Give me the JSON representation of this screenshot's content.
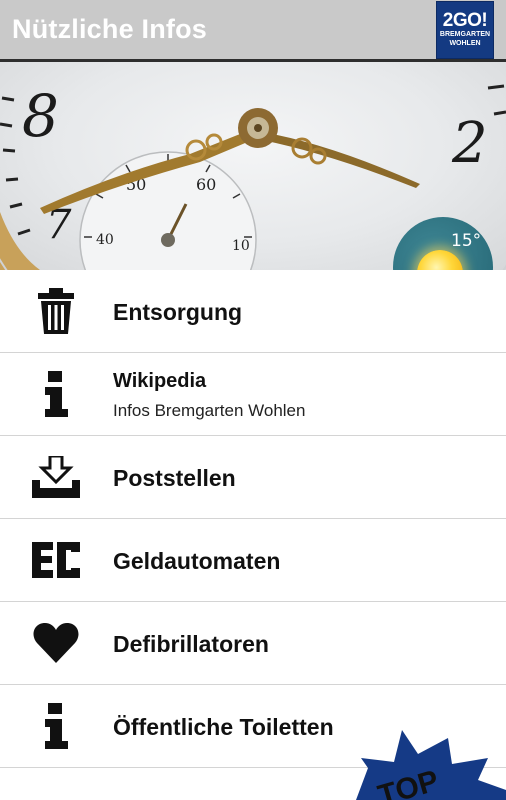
{
  "header": {
    "title": "Nützliche Infos",
    "logo": {
      "big": "2GO!",
      "line1": "BREMGARTEN",
      "line2": "WOHLEN"
    }
  },
  "hero": {
    "weather": {
      "temperature": "15°",
      "icon": "sun-icon"
    }
  },
  "menu": {
    "items": [
      {
        "label": "Entsorgung",
        "icon": "trash-icon"
      },
      {
        "label": "Wikipedia",
        "sublabel": "Infos Bremgarten Wohlen",
        "icon": "info-icon"
      },
      {
        "label": "Poststellen",
        "icon": "inbox-download-icon"
      },
      {
        "label": "Geldautomaten",
        "icon": "ec-icon"
      },
      {
        "label": "Defibrillatoren",
        "icon": "heart-icon"
      },
      {
        "label": "Öffentliche Toiletten",
        "icon": "info-icon"
      }
    ]
  },
  "badge": {
    "label": "TOP"
  },
  "colors": {
    "app_bar": "#c9c9c9",
    "logo": "#143a82",
    "weather": "#2c6f7d",
    "text": "#111111"
  }
}
